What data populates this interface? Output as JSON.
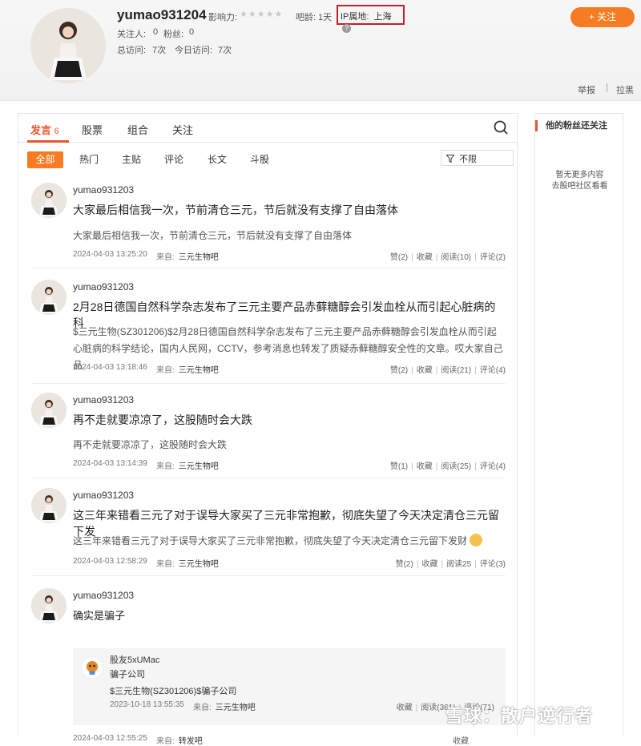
{
  "profile": {
    "username": "yumao931204",
    "influence_label": "影响力:",
    "influence_stars": "★★★★★",
    "age_label": "吧龄:",
    "age_value": "1天",
    "ip_label": "IP属地:",
    "ip_value": "上海",
    "ip_help": "?",
    "following_label": "关注人:",
    "following_value": "0",
    "fans_label": "粉丝:",
    "fans_value": "0",
    "total_visits_label": "总访问:",
    "total_visits_value": "7次",
    "today_visits_label": "今日访问:",
    "today_visits_value": "7次",
    "follow_button": "+ 关注",
    "report": "举报",
    "block": "拉黑",
    "separator": "|"
  },
  "tabs": {
    "posts_label": "发言",
    "posts_count": "6",
    "stocks": "股票",
    "portfolio": "组合",
    "follow": "关注"
  },
  "filters": {
    "all": "全部",
    "hot": "热门",
    "main_post": "主贴",
    "comment": "评论",
    "long_article": "长文",
    "fight": "斗股",
    "select_value": "不限"
  },
  "posts": [
    {
      "user": "yumao931203",
      "title": "大家最后相信我一次，节前清仓三元，节后就没有支撑了自由落体",
      "body": "大家最后相信我一次，节前清仓三元，节后就没有支撑了自由落体",
      "time": "2024-04-03 13:25:20",
      "from_label": "来自:",
      "from": "三元生物吧",
      "likes": "赞(2)",
      "fav": "收藏",
      "reads": "阅读(10)",
      "comments": "评论(2)"
    },
    {
      "user": "yumao931203",
      "title": "2月28日德国自然科学杂志发布了三元主要产品赤藓糖醇会引发血栓从而引起心脏病的科",
      "body": "$三元生物(SZ301206)$2月28日德国自然科学杂志发布了三元主要产品赤藓糖醇会引发血栓从而引起心脏病的科学结论，国内人民网，CCTV，参考消息也转发了质疑赤藓糖醇安全性的文章。哎大家自己品",
      "time": "2024-04-03 13:18:46",
      "from_label": "来自:",
      "from": "三元生物吧",
      "likes": "赞(2)",
      "fav": "收藏",
      "reads": "阅读(21)",
      "comments": "评论(4)"
    },
    {
      "user": "yumao931203",
      "title": "再不走就要凉凉了，这股随时会大跌",
      "body": "再不走就要凉凉了，这股随时会大跌",
      "time": "2024-04-03 13:14:39",
      "from_label": "来自:",
      "from": "三元生物吧",
      "likes": "赞(1)",
      "fav": "收藏",
      "reads": "阅读(25)",
      "comments": "评论(4)"
    },
    {
      "user": "yumao931203",
      "title": "这三年来错看三元了对于误导大家买了三元非常抱歉，彻底失望了今天决定清仓三元留下发",
      "body": "这三年来错看三元了对于误导大家买了三元非常抱歉，彻底失望了今天决定清仓三元留下发财",
      "time": "2024-04-03 12:58:29",
      "from_label": "来自:",
      "from": "三元生物吧",
      "likes": "赞(2)",
      "fav": "收藏",
      "reads": "阅读25",
      "comments": "评论(3)"
    },
    {
      "user": "yumao931203",
      "title": "确实是骗子",
      "time": "2024-04-03 12:55:25",
      "from_label": "来自:",
      "from": "转发吧",
      "fav": "收藏",
      "repost": {
        "user": "股友5xUMac",
        "title": "骗子公司",
        "body": "$三元生物(SZ301206)$骗子公司",
        "time": "2023-10-18 13:55:35",
        "from_label": "来自:",
        "from": "三元生物吧",
        "fav": "收藏",
        "reads": "阅读(361)",
        "comments": "评论(71)"
      }
    }
  ],
  "side": {
    "title": "他的粉丝还关注",
    "empty_line1": "暂无更多内容",
    "empty_line2": "去股吧社区看看"
  },
  "watermark": "雪球：散户逆行者",
  "colors": {
    "accent": "#f57c22",
    "active_tab": "#e4572e",
    "ip_border": "#c8202a"
  }
}
